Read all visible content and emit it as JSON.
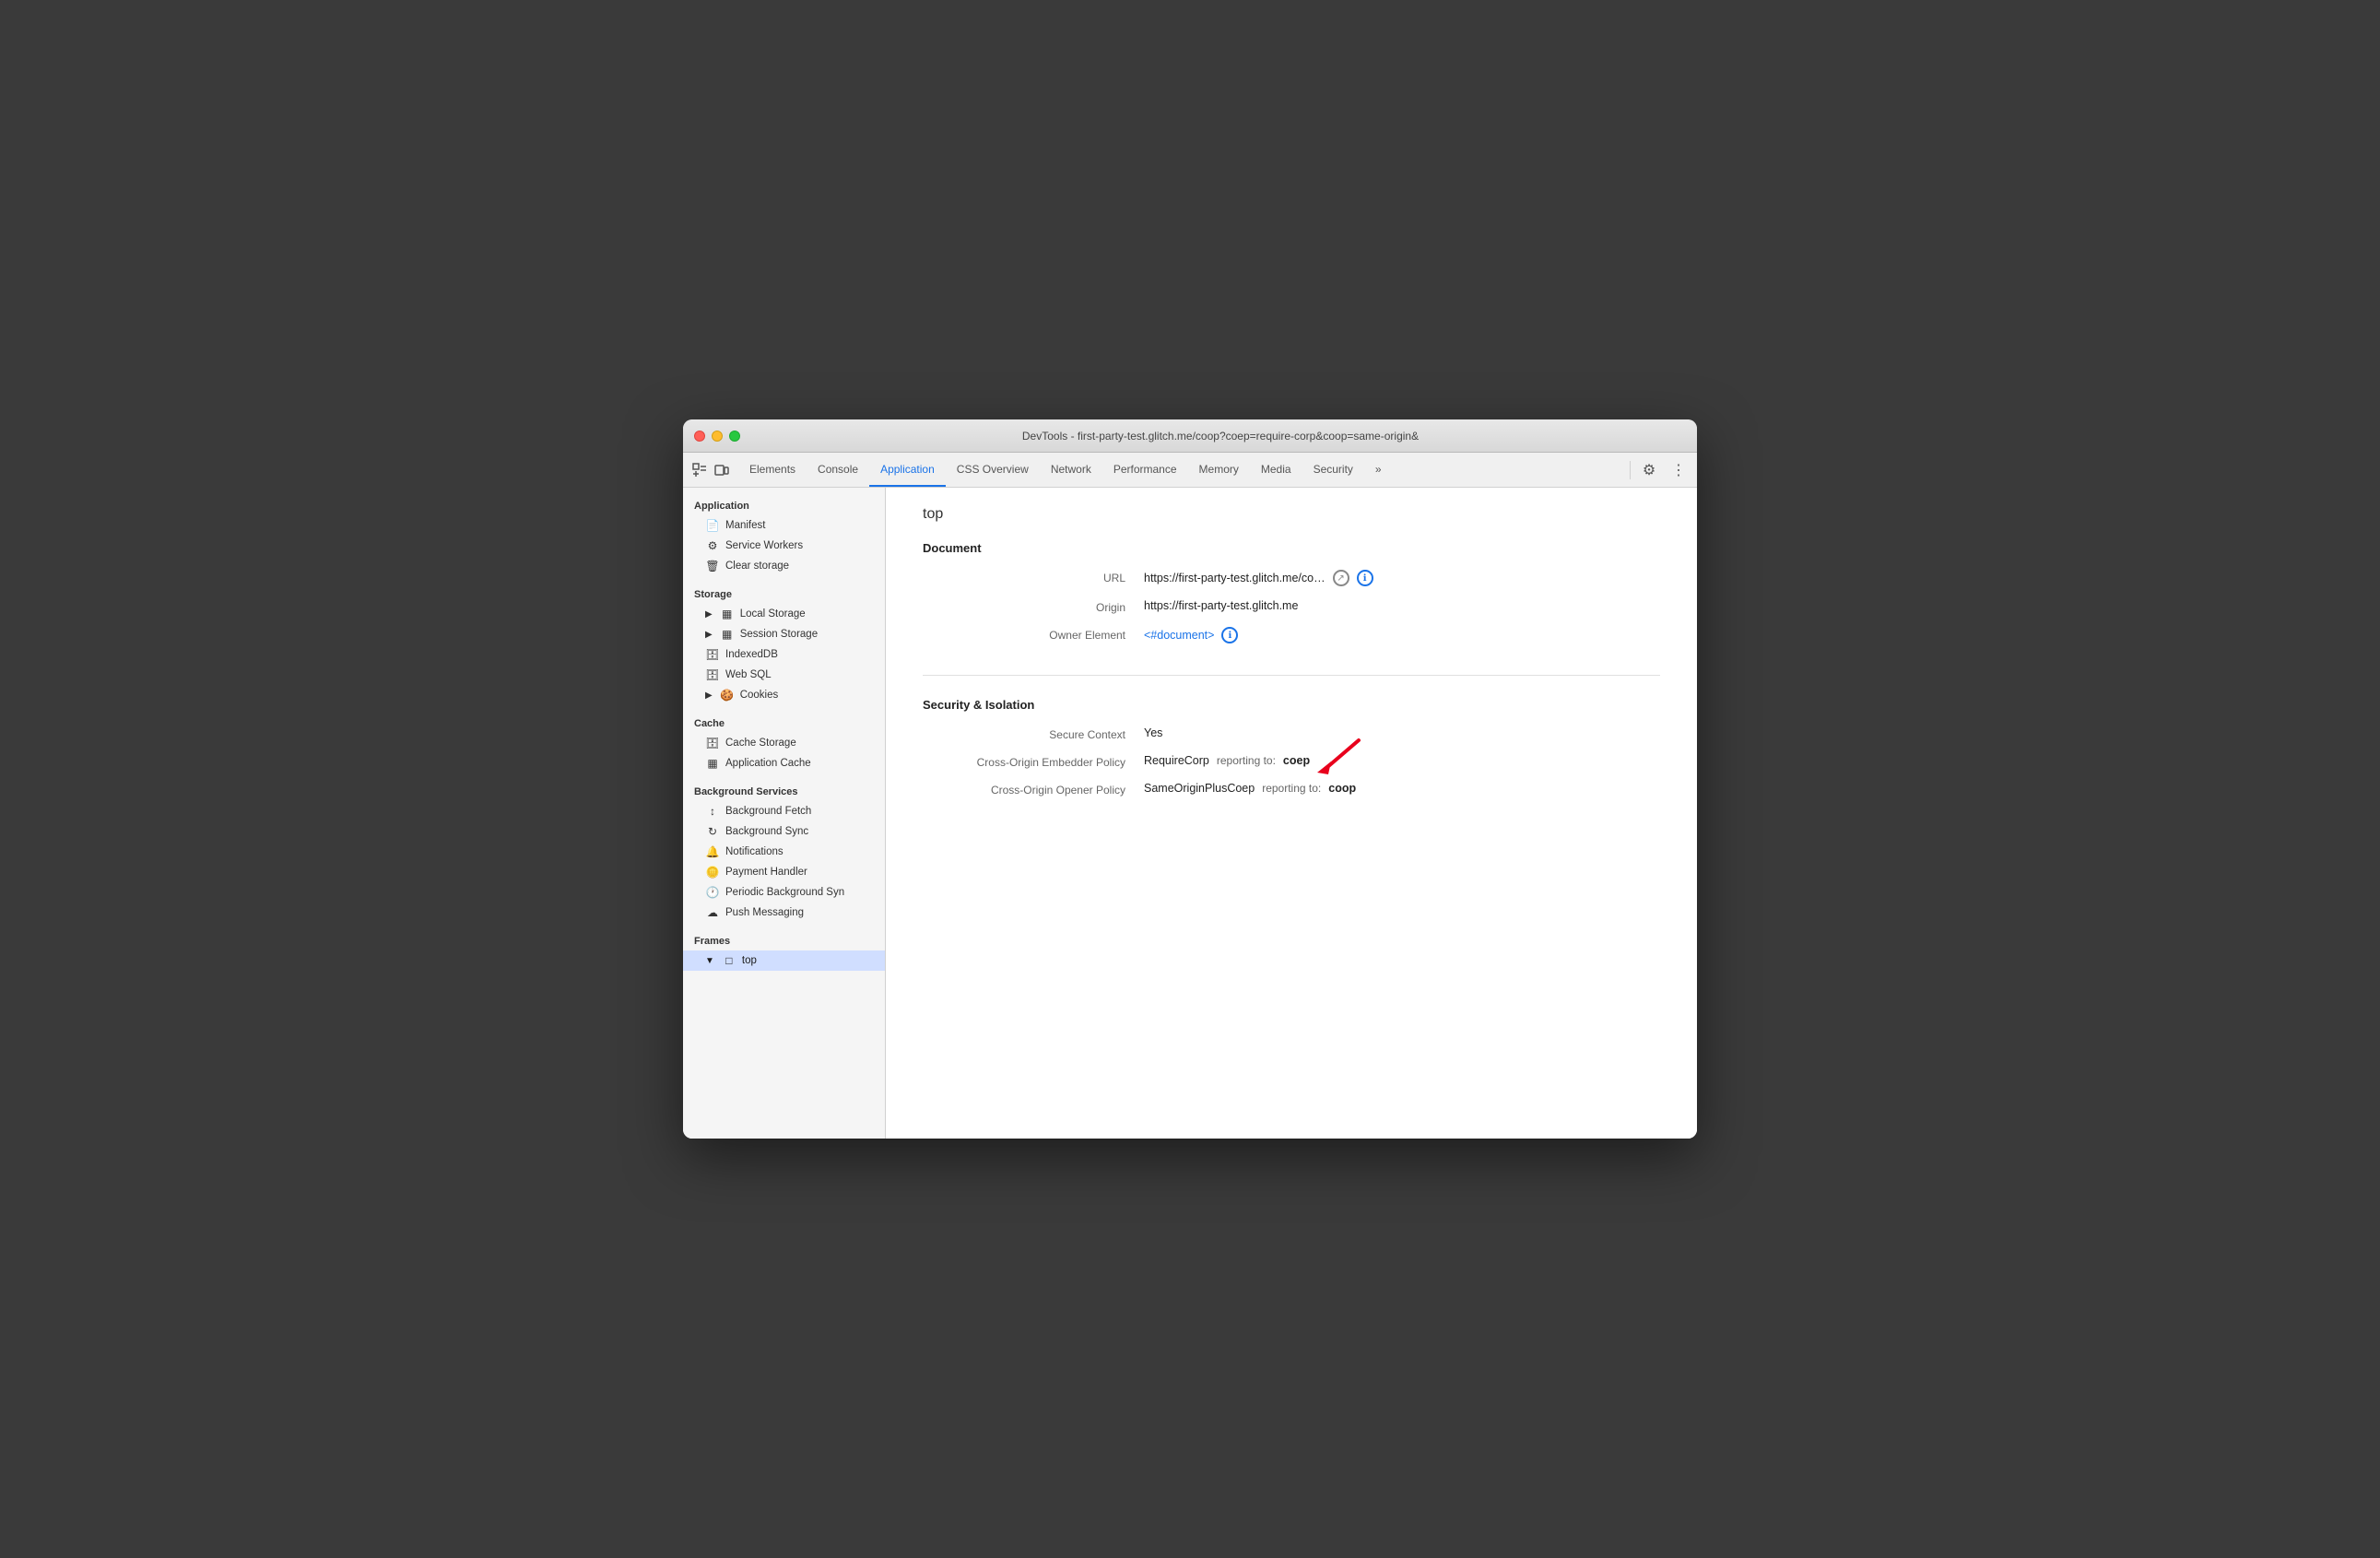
{
  "window": {
    "title": "DevTools - first-party-test.glitch.me/coop?coep=require-corp&coop=same-origin&"
  },
  "tabbar": {
    "tabs": [
      {
        "id": "elements",
        "label": "Elements",
        "active": false
      },
      {
        "id": "console",
        "label": "Console",
        "active": false
      },
      {
        "id": "application",
        "label": "Application",
        "active": true
      },
      {
        "id": "css-overview",
        "label": "CSS Overview",
        "active": false
      },
      {
        "id": "network",
        "label": "Network",
        "active": false
      },
      {
        "id": "performance",
        "label": "Performance",
        "active": false
      },
      {
        "id": "memory",
        "label": "Memory",
        "active": false
      },
      {
        "id": "media",
        "label": "Media",
        "active": false
      },
      {
        "id": "security",
        "label": "Security",
        "active": false
      }
    ],
    "more_label": "»"
  },
  "sidebar": {
    "application_section": "Application",
    "application_items": [
      {
        "id": "manifest",
        "label": "Manifest",
        "icon": "📄"
      },
      {
        "id": "service-workers",
        "label": "Service Workers",
        "icon": "⚙"
      },
      {
        "id": "clear-storage",
        "label": "Clear storage",
        "icon": "🗑"
      }
    ],
    "storage_section": "Storage",
    "storage_items": [
      {
        "id": "local-storage",
        "label": "Local Storage",
        "icon": "▦",
        "expandable": true
      },
      {
        "id": "session-storage",
        "label": "Session Storage",
        "icon": "▦",
        "expandable": true
      },
      {
        "id": "indexeddb",
        "label": "IndexedDB",
        "icon": "🗄"
      },
      {
        "id": "web-sql",
        "label": "Web SQL",
        "icon": "🗄"
      },
      {
        "id": "cookies",
        "label": "Cookies",
        "icon": "🍪",
        "expandable": true
      }
    ],
    "cache_section": "Cache",
    "cache_items": [
      {
        "id": "cache-storage",
        "label": "Cache Storage",
        "icon": "🗄"
      },
      {
        "id": "application-cache",
        "label": "Application Cache",
        "icon": "▦"
      }
    ],
    "background_section": "Background Services",
    "background_items": [
      {
        "id": "background-fetch",
        "label": "Background Fetch",
        "icon": "↕"
      },
      {
        "id": "background-sync",
        "label": "Background Sync",
        "icon": "↻"
      },
      {
        "id": "notifications",
        "label": "Notifications",
        "icon": "🔔"
      },
      {
        "id": "payment-handler",
        "label": "Payment Handler",
        "icon": "🪙"
      },
      {
        "id": "periodic-bg-sync",
        "label": "Periodic Background Syn",
        "icon": "🕐"
      },
      {
        "id": "push-messaging",
        "label": "Push Messaging",
        "icon": "☁"
      }
    ],
    "frames_section": "Frames",
    "frames_items": [
      {
        "id": "top-frame",
        "label": "top",
        "icon": "□",
        "expanded": true
      }
    ]
  },
  "content": {
    "page_title": "top",
    "document_section": "Document",
    "fields": {
      "url_label": "URL",
      "url_value": "https://first-party-test.glitch.me/co…",
      "origin_label": "Origin",
      "origin_value": "https://first-party-test.glitch.me",
      "owner_element_label": "Owner Element",
      "owner_element_link": "<#document>"
    },
    "security_section": "Security & Isolation",
    "security_fields": {
      "secure_context_label": "Secure Context",
      "secure_context_value": "Yes",
      "coep_label": "Cross-Origin Embedder Policy",
      "coep_policy": "RequireCorp",
      "coep_reporting_label": "reporting to:",
      "coep_reporting_value": "coep",
      "coop_label": "Cross-Origin Opener Policy",
      "coop_policy": "SameOriginPlusCoep",
      "coop_reporting_label": "reporting to:",
      "coop_reporting_value": "coop"
    }
  }
}
